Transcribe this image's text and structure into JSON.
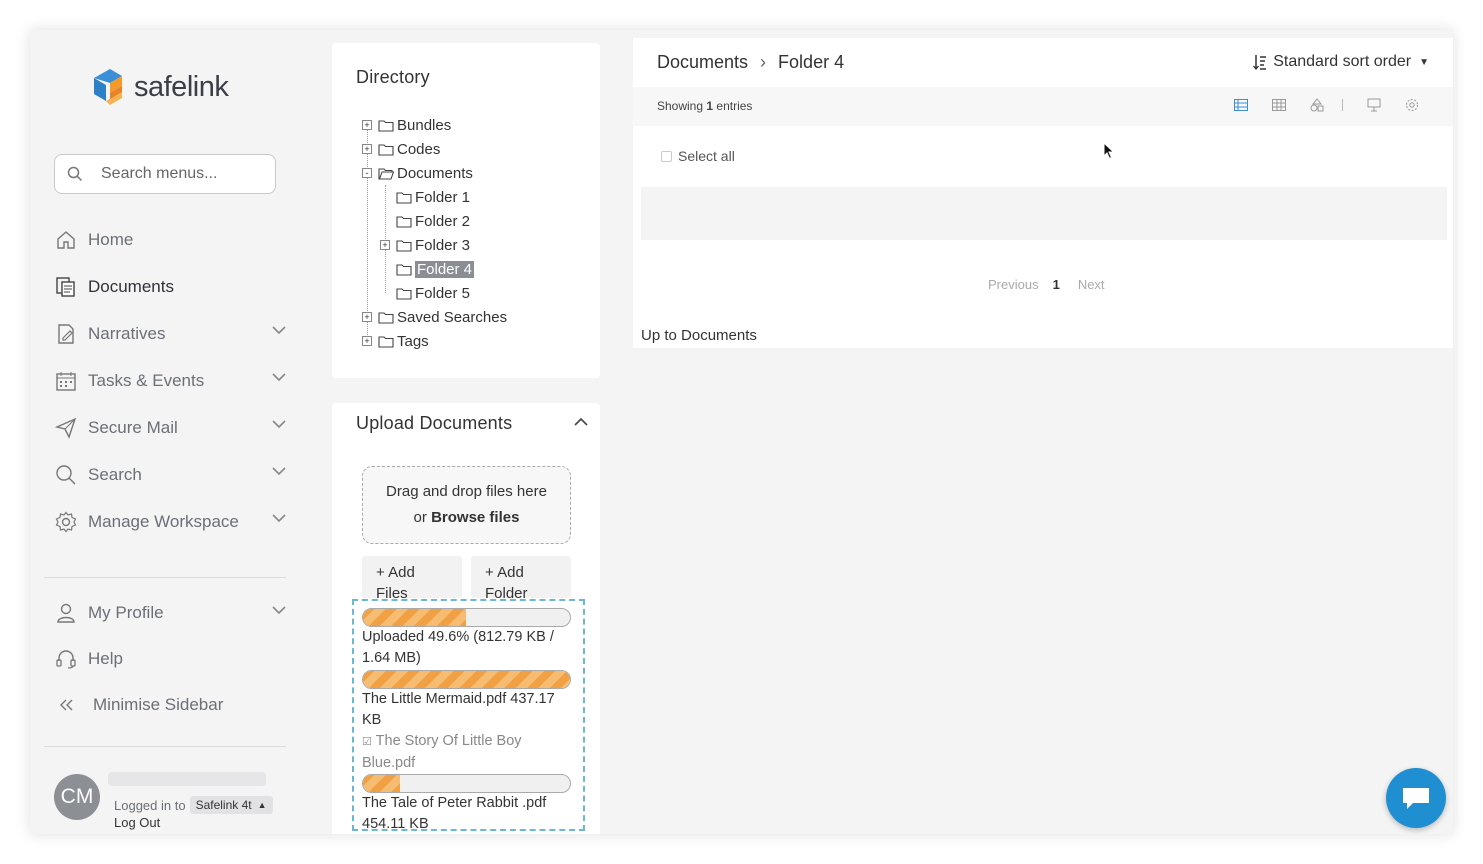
{
  "brand": {
    "name": "safelink",
    "colors": {
      "blue": "#2d7fc6",
      "orange": "#f1a143",
      "chat": "#1f8fd2"
    }
  },
  "sidebar": {
    "search_placeholder": "Search menus...",
    "items": [
      {
        "label": "Home",
        "icon": "home-icon",
        "active": false
      },
      {
        "label": "Documents",
        "icon": "documents-icon",
        "active": true
      },
      {
        "label": "Narratives",
        "icon": "narratives-icon",
        "expandable": true
      },
      {
        "label": "Tasks & Events",
        "icon": "calendar-icon",
        "expandable": true
      },
      {
        "label": "Secure Mail",
        "icon": "paper-plane-icon",
        "expandable": true
      },
      {
        "label": "Search",
        "icon": "search-icon",
        "expandable": true
      },
      {
        "label": "Manage Workspace",
        "icon": "gear-icon",
        "expandable": true
      }
    ],
    "items2": [
      {
        "label": "My Profile",
        "icon": "user-icon",
        "expandable": true
      },
      {
        "label": "Help",
        "icon": "headset-icon"
      },
      {
        "label": "Minimise Sidebar",
        "icon": "double-chevron-left-icon"
      }
    ],
    "footer": {
      "avatar_initials": "CM",
      "logged_in_label": "Logged in to",
      "workspace": "Safelink 4t",
      "logout": "Log Out"
    }
  },
  "directory": {
    "title": "Directory",
    "tree": [
      {
        "label": "Bundles",
        "level": 0,
        "expander": "+"
      },
      {
        "label": "Codes",
        "level": 0,
        "expander": "+"
      },
      {
        "label": "Documents",
        "level": 0,
        "expander": "-",
        "open": true
      },
      {
        "label": "Folder 1",
        "level": 1
      },
      {
        "label": "Folder 2",
        "level": 1
      },
      {
        "label": "Folder 3",
        "level": 1,
        "expander": "+"
      },
      {
        "label": "Folder 4",
        "level": 1,
        "selected": true
      },
      {
        "label": "Folder 5",
        "level": 1
      },
      {
        "label": "Saved Searches",
        "level": 0,
        "expander": "+"
      },
      {
        "label": "Tags",
        "level": 0,
        "expander": "+"
      }
    ]
  },
  "upload": {
    "title": "Upload Documents",
    "dropzone_line1": "Drag and drop files here",
    "dropzone_or": "or",
    "dropzone_browse": "Browse files",
    "add_files": "+  Add Files",
    "add_folder": "+  Add Folder",
    "overall_progress": 0.496,
    "overall_text": "Uploaded 49.6% (812.79 KB / 1.64 MB)",
    "files": [
      {
        "progress": 1.0,
        "text": "The Little Mermaid.pdf 437.17 KB"
      },
      {
        "text": "The Story Of Little Boy Blue.pdf",
        "done": true
      },
      {
        "progress": 0.18,
        "text": "The Tale of Peter Rabbit .pdf 454.11 KB"
      }
    ]
  },
  "main": {
    "breadcrumb": [
      "Documents",
      "Folder 4"
    ],
    "sort_label": "Standard sort order",
    "showing_prefix": "Showing",
    "showing_count": "1",
    "showing_suffix": "entries",
    "select_all": "Select all",
    "pager": {
      "previous": "Previous",
      "current": "1",
      "next": "Next"
    },
    "up_link": "Up to Documents"
  }
}
